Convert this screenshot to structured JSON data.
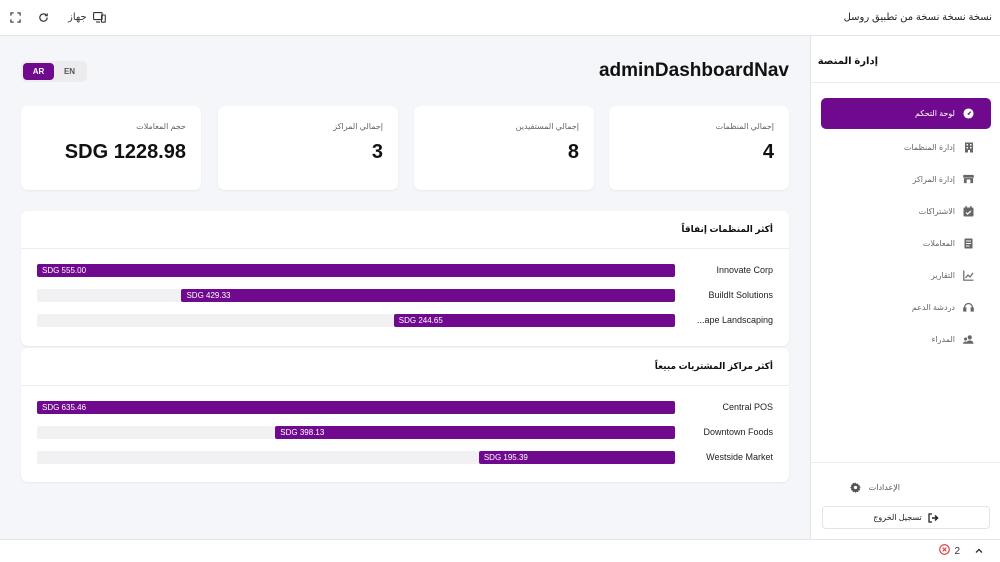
{
  "window": {
    "title": "نسخة نسخة نسخة من تطبيق روسل",
    "device_label": "جهاز"
  },
  "main": {
    "page_title": "adminDashboardNav",
    "lang": {
      "ar": "AR",
      "en": "EN",
      "active": "AR"
    },
    "stats": [
      {
        "label": "إجمالي المنظمات",
        "value": "4"
      },
      {
        "label": "إجمالي المستفيدين",
        "value": "8"
      },
      {
        "label": "إجمالي المراكز",
        "value": "3"
      },
      {
        "label": "حجم المعاملات",
        "value": "SDG 1228.98"
      }
    ],
    "top_orgs": {
      "title": "أكثر المنظمات إنفاقاً",
      "rows": [
        {
          "name": "Innovate Corp",
          "value_label": "SDG 555.00",
          "value": 555.0
        },
        {
          "name": "BuildIt Solutions",
          "value_label": "SDG 429.33",
          "value": 429.33
        },
        {
          "name": "...ape Landscaping",
          "value_label": "SDG 244.65",
          "value": 244.65
        }
      ]
    },
    "top_pos": {
      "title": "أكثر مراكز المشتريات مبيعاً",
      "rows": [
        {
          "name": "Central POS",
          "value_label": "SDG 635.46",
          "value": 635.46
        },
        {
          "name": "Downtown Foods",
          "value_label": "SDG 398.13",
          "value": 398.13
        },
        {
          "name": "Westside Market",
          "value_label": "SDG 195.39",
          "value": 195.39
        }
      ]
    }
  },
  "sidebar": {
    "title": "إدارة المنصة",
    "items": [
      {
        "label": "لوحة التحكم",
        "icon": "dashboard-icon",
        "active": true
      },
      {
        "label": "إدارة المنظمات",
        "icon": "building-icon",
        "active": false
      },
      {
        "label": "إدارة المراكز",
        "icon": "store-icon",
        "active": false
      },
      {
        "label": "الاشتراكات",
        "icon": "calendar-icon",
        "active": false
      },
      {
        "label": "المعاملات",
        "icon": "document-icon",
        "active": false
      },
      {
        "label": "التقارير",
        "icon": "chart-icon",
        "active": false
      },
      {
        "label": "دردشة الدعم",
        "icon": "headset-icon",
        "active": false
      },
      {
        "label": "المدراء",
        "icon": "users-icon",
        "active": false
      }
    ],
    "settings_label": "الإعدادات",
    "logout_label": "تسجيل الخروج"
  },
  "statusbar": {
    "error_count": "2"
  },
  "colors": {
    "accent": "#6f0a8e",
    "background": "#f5f6fa"
  }
}
